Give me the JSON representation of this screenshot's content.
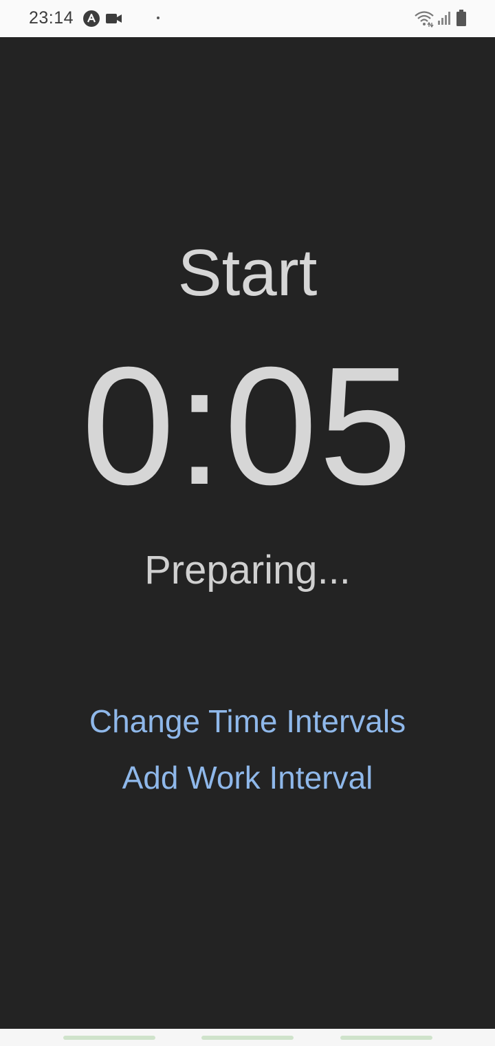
{
  "status_bar": {
    "time": "23:14",
    "icons": [
      "app-notification-icon",
      "video-camera-icon",
      "dot-icon",
      "wifi-icon",
      "signal-icon",
      "battery-icon"
    ]
  },
  "timer_screen": {
    "phase_title": "Start",
    "time_remaining": "0:05",
    "status": "Preparing..."
  },
  "actions": {
    "change_intervals_label": "Change Time Intervals",
    "add_work_interval_label": "Add Work Interval"
  },
  "colors": {
    "background": "#232323",
    "primary_text": "#d6d6d6",
    "link": "#8fb8ea"
  }
}
